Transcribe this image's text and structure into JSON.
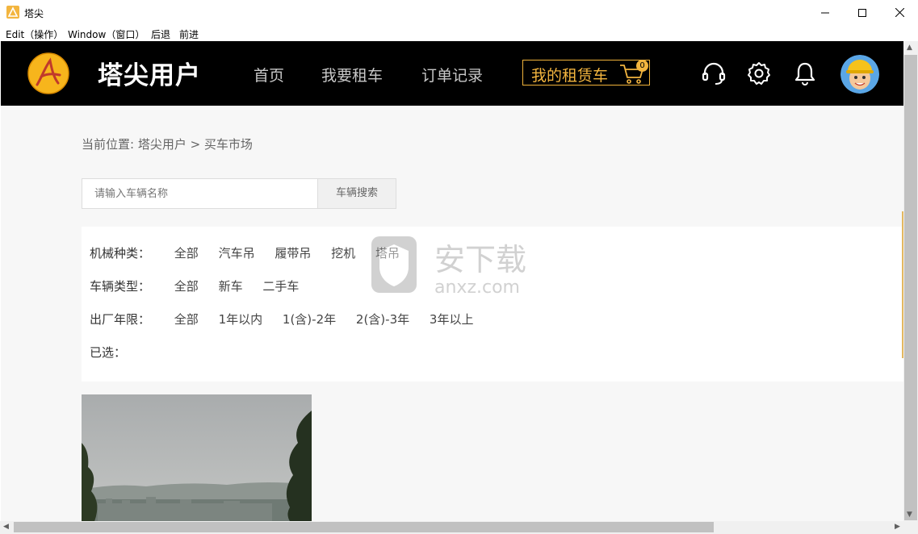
{
  "window": {
    "title": "塔尖",
    "menu": [
      "Edit（操作）",
      "Window（窗口）",
      "后退",
      "前进"
    ]
  },
  "header": {
    "brand": "塔尖用户",
    "nav": [
      "首页",
      "我要租车",
      "订单记录"
    ],
    "rent_label": "我的租赁车",
    "cart_count": "0",
    "accent_color": "#f3b53f"
  },
  "breadcrumb": "当前位置:  塔尖用户 > 买车市场",
  "search": {
    "placeholder": "请输入车辆名称",
    "button": "车辆搜索"
  },
  "filters": {
    "machine": {
      "label": "机械种类：",
      "options": [
        "全部",
        "汽车吊",
        "履带吊",
        "挖机",
        "塔吊"
      ]
    },
    "vehicle": {
      "label": "车辆类型：",
      "options": [
        "全部",
        "新车",
        "二手车"
      ]
    },
    "age": {
      "label": "出厂年限：",
      "options": [
        "全部",
        "1年以内",
        "1(含)-2年",
        "2(含)-3年",
        "3年以上"
      ]
    },
    "selected": {
      "label": "已选："
    }
  },
  "watermark": {
    "text": "安下载",
    "sub": "anxz.com"
  }
}
